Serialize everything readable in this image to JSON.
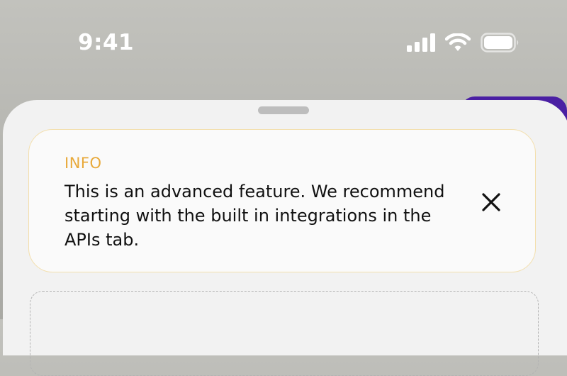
{
  "status_bar": {
    "time": "9:41",
    "icons": [
      "cellular-signal-icon",
      "wifi-icon",
      "battery-icon"
    ],
    "color": "#ffffff"
  },
  "info_banner": {
    "tag": "INFO",
    "message": "This is an advanced feature. We recommend starting with the built in integrations in the APIs tab.",
    "close_icon": "close-icon",
    "tag_color": "#e8a93a",
    "border_color": "#f3dfad"
  },
  "colors": {
    "accent": "#4a1fa3",
    "sheet_background": "#f2f2f2",
    "card_background": "#fafafa"
  }
}
